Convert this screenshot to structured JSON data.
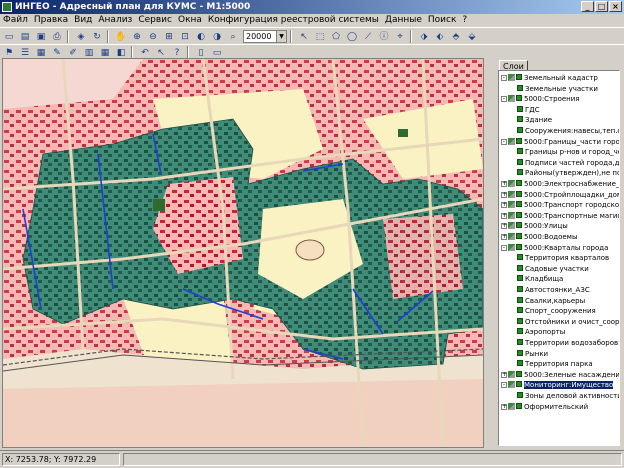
{
  "window": {
    "title": "ИНГЕО - Адресный план для КУМС - М1:5000",
    "minimize": "_",
    "maximize": "□",
    "close": "×"
  },
  "menu": [
    "Файл",
    "Правка",
    "Вид",
    "Анализ",
    "Сервис",
    "Окна",
    "Конфигурация реестровой системы",
    "Данные",
    "Поиск",
    "?"
  ],
  "toolbar": {
    "scale_value": "20000"
  },
  "side_panel": {
    "tab_label": "Слои",
    "tree": [
      {
        "level": 0,
        "expand": "-",
        "label": "Земельный кадастр"
      },
      {
        "level": 1,
        "label": "Земельные участки"
      },
      {
        "level": 0,
        "expand": "-",
        "label": "5000:Строения"
      },
      {
        "level": 1,
        "label": "ГДС"
      },
      {
        "level": 1,
        "label": "Здание"
      },
      {
        "level": 1,
        "label": "Сооружения:навесы,теп.с"
      },
      {
        "level": 0,
        "expand": "-",
        "label": "5000:Границы_части города_д"
      },
      {
        "level": 1,
        "label": "Границы р-нов и город_чер"
      },
      {
        "level": 1,
        "label": "Подписи частей города,де"
      },
      {
        "level": 1,
        "label": "Районы(утвержден),не под"
      },
      {
        "level": 0,
        "expand": "+",
        "label": "5000:Электроснабжение_Стро"
      },
      {
        "level": 0,
        "expand": "+",
        "label": "5000:Стройплощадки_дома стр"
      },
      {
        "level": 0,
        "expand": "+",
        "label": "5000:Транспорт городской"
      },
      {
        "level": 0,
        "expand": "+",
        "label": "5000:Транспортные магистра"
      },
      {
        "level": 0,
        "expand": "+",
        "label": "5000:Улицы"
      },
      {
        "level": 0,
        "expand": "+",
        "label": "5000:Водоемы"
      },
      {
        "level": 0,
        "expand": "-",
        "label": "5000:Кварталы города"
      },
      {
        "level": 1,
        "label": "Территория кварталов"
      },
      {
        "level": 1,
        "label": "Садовые участки"
      },
      {
        "level": 1,
        "label": "Кладбища"
      },
      {
        "level": 1,
        "label": "Автостоянки_АЗС"
      },
      {
        "level": 1,
        "label": "Свалки,карьеры"
      },
      {
        "level": 1,
        "label": "Спорт_сооружения"
      },
      {
        "level": 1,
        "label": "Отстойники и очист_сооруж"
      },
      {
        "level": 1,
        "label": "Аэропорты"
      },
      {
        "level": 1,
        "label": "Территории водозаборов"
      },
      {
        "level": 1,
        "label": "Рынки"
      },
      {
        "level": 1,
        "label": "Территория парка"
      },
      {
        "level": 0,
        "expand": "+",
        "label": "5000:Зеленые насаждения пр"
      },
      {
        "level": 0,
        "expand": "-",
        "label": "Мониторинг:Имущество",
        "selected": true
      },
      {
        "level": 1,
        "label": "Зоны деловой активности"
      },
      {
        "level": 0,
        "expand": "+",
        "label": "Оформительский"
      }
    ]
  },
  "status": {
    "coordinates": "X: 7253.78; Y: 7972.29"
  },
  "colors": {
    "map_pink": "#f4b9b3",
    "map_green_zone": "#3f8c78",
    "map_blue_road": "#1f3fd8",
    "map_yellow": "#fbf2c4",
    "selection": "#0a246a"
  }
}
